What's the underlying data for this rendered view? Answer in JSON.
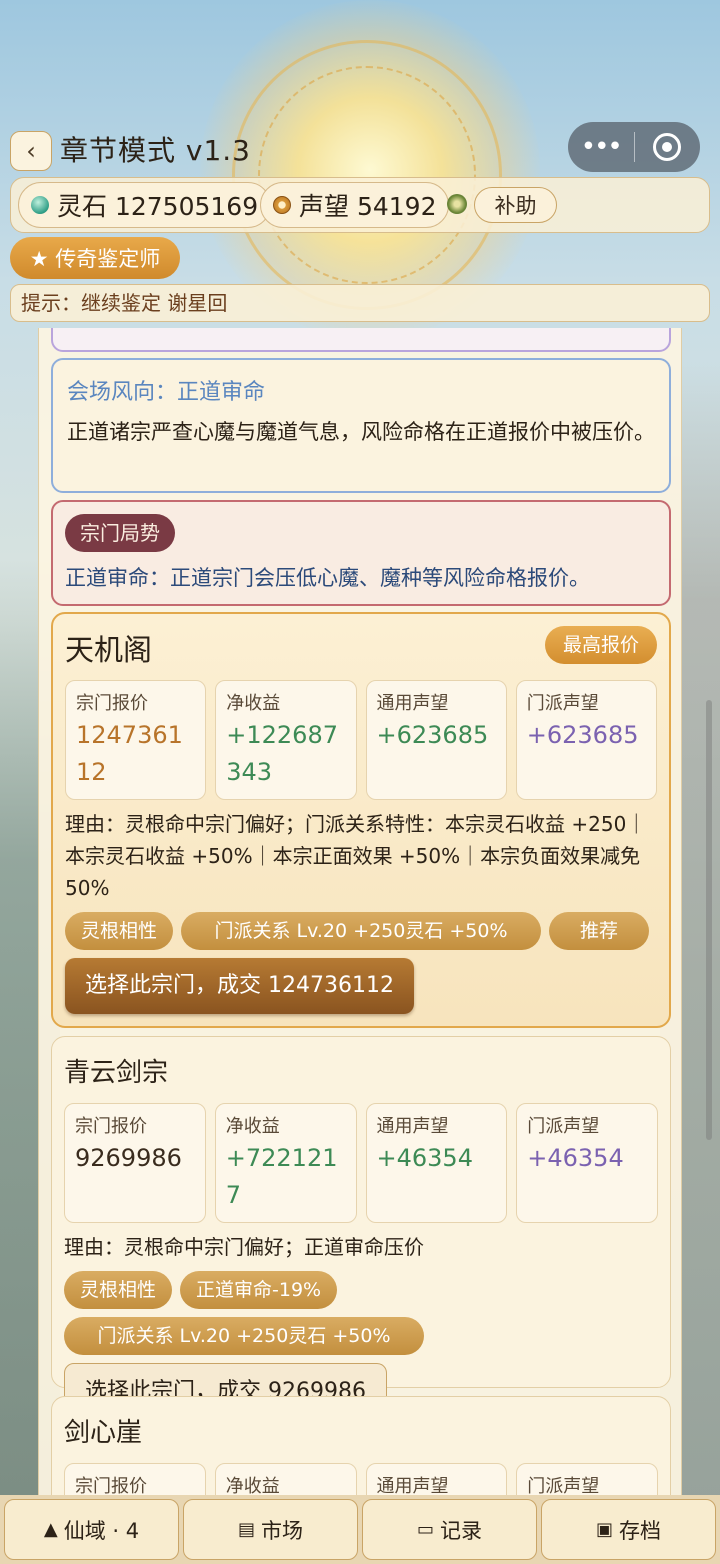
{
  "header": {
    "back_icon": "chevron-left-icon",
    "back_glyph": "‹",
    "title": "章节模式 v1.3",
    "capsule_more": "•••"
  },
  "resources": {
    "spirit_stone": "灵石 127505169",
    "reputation": "声望 54192",
    "aid_label": "补助"
  },
  "rank_badge": "★ 传奇鉴定师",
  "hint": "提示：继续鉴定 谢星回",
  "market_wind": {
    "heading": "会场风向：正道审命",
    "text": "正道诸宗严查心魔与魔道气息，风险命格在正道报价中被压价。"
  },
  "sect_situation": {
    "tag": "宗门局势",
    "text": "正道审命：正道宗门会压低心魔、魔种等风险命格报价。"
  },
  "stat_labels": {
    "sect_offer": "宗门报价",
    "net_gain": "净收益",
    "general_rep": "通用声望",
    "faction_rep": "门派声望"
  },
  "sects": [
    {
      "name": "天机阁",
      "badge": "最高报价",
      "offer": "124736112",
      "net_gain": "+122687343",
      "general_rep": "+623685",
      "faction_rep": "+623685",
      "reason": "理由：灵根命中宗门偏好；门派关系特性：本宗灵石收益 +250｜本宗灵石收益 +50%｜本宗正面效果 +50%｜本宗负面效果减免 50%",
      "tags": [
        "灵根相性",
        "门派关系 Lv.20 +250灵石 +50%",
        "推荐"
      ],
      "deal": "选择此宗门，成交 124736112"
    },
    {
      "name": "青云剑宗",
      "offer": "9269986",
      "net_gain": "+7221217",
      "general_rep": "+46354",
      "faction_rep": "+46354",
      "reason": "理由：灵根命中宗门偏好；正道审命压价",
      "tags": [
        "灵根相性",
        "正道审命-19%",
        "门派关系 Lv.20 +250灵石 +50%"
      ],
      "deal": "选择此宗门，成交 9269986"
    },
    {
      "name": "剑心崖"
    }
  ],
  "bottom_nav": [
    {
      "icon": "mountain-icon",
      "glyph": "▲",
      "label": "仙域 · 4"
    },
    {
      "icon": "clipboard-icon",
      "glyph": "▤",
      "label": "市场"
    },
    {
      "icon": "book-icon",
      "glyph": "▭",
      "label": "记录"
    },
    {
      "icon": "floppy-icon",
      "glyph": "▣",
      "label": "存档"
    }
  ]
}
